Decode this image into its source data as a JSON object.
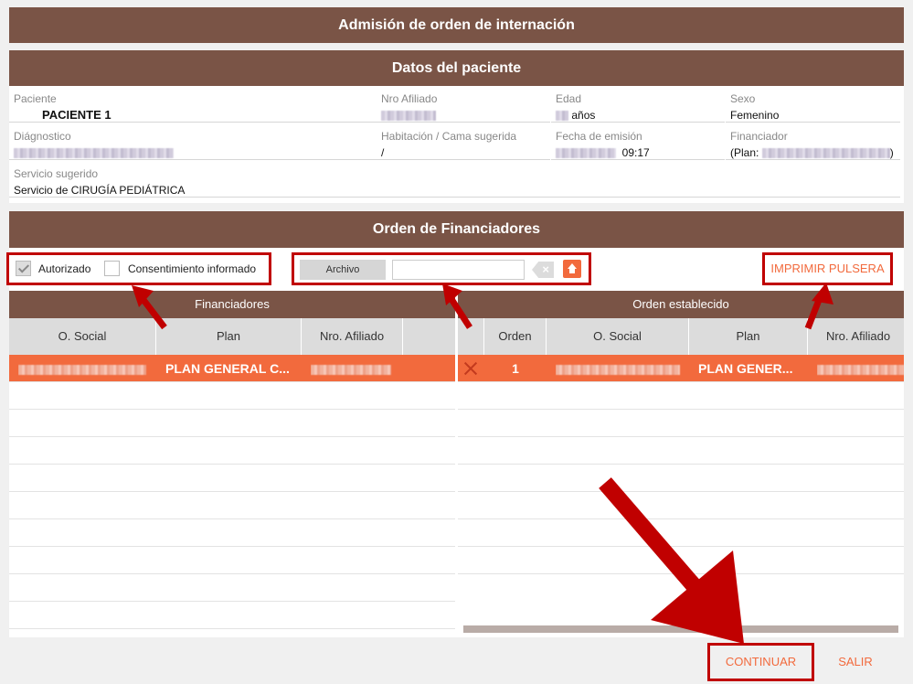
{
  "title": "Admisión de orden de internación",
  "patient": {
    "section_title": "Datos del paciente",
    "paciente_label": "Paciente",
    "paciente_value": "PACIENTE 1",
    "nro_afiliado_label": "Nro Afiliado",
    "edad_label": "Edad",
    "edad_unit": "años",
    "sexo_label": "Sexo",
    "sexo_value": "Femenino",
    "diagnostico_label": "Diágnostico",
    "habitacion_label": "Habitación / Cama sugerida",
    "habitacion_value": "/",
    "fecha_label": "Fecha de emisión",
    "fecha_time": "09:17",
    "financiador_label": "Financiador",
    "financiador_prefix": "(Plan:",
    "financiador_suffix": ")",
    "servicio_label": "Servicio sugerido",
    "servicio_value": "Servicio de CIRUGÍA PEDIÁTRICA"
  },
  "financiadores": {
    "section_title": "Orden de Financiadores",
    "autorizado_label": "Autorizado",
    "autorizado_checked": true,
    "consentimiento_label": "Consentimiento informado",
    "consentimiento_checked": false,
    "archivo_label": "Archivo",
    "imprimir_label": "IMPRIMIR PULSERA",
    "left_grid": {
      "title": "Financiadores",
      "columns": [
        "O. Social",
        "Plan",
        "Nro. Afiliado"
      ],
      "rows": [
        {
          "plan": "PLAN GENERAL C..."
        }
      ]
    },
    "right_grid": {
      "title": "Orden establecido",
      "columns": [
        "Orden",
        "O. Social",
        "Plan",
        "Nro. Afiliado"
      ],
      "rows": [
        {
          "orden": "1",
          "plan": "PLAN GENER..."
        }
      ]
    }
  },
  "footer": {
    "continuar_label": "CONTINUAR",
    "salir_label": "SALIR"
  },
  "colors": {
    "header_brown": "#7a5446",
    "accent_orange": "#f26a3d",
    "annotation_red": "#c00000"
  }
}
